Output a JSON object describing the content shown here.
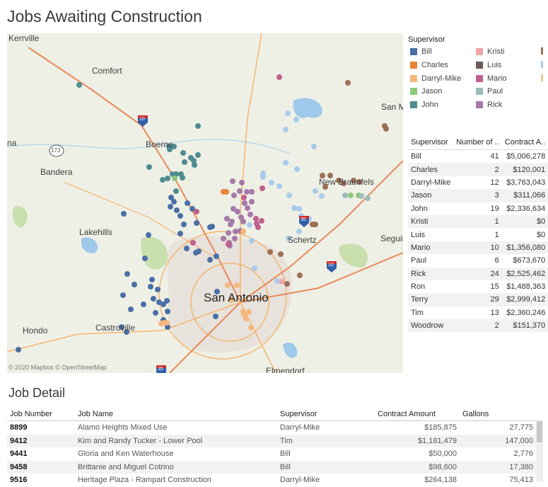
{
  "title": "Jobs Awaiting Construction",
  "map": {
    "attribution": "© 2020 Mapbox  © OpenStreetMap",
    "places": {
      "kerrville": "Kerrville",
      "comfort": "Comfort",
      "boerne": "Boerne",
      "bandera": "Bandera",
      "lakehills": "Lakehills",
      "castroville": "Castroville",
      "hondo": "Hondo",
      "san_antonio": "San Antonio",
      "schertz": "Schertz",
      "new_braunfels": "New Braunfels",
      "seguin": "Seguin",
      "san_marcos": "San Ma",
      "elmendorf": "Elmendorf",
      "helotes": "na"
    },
    "shields": {
      "i10_north": "10",
      "i35_ne": "35",
      "i10_east": "10",
      "i35_south": "35",
      "hwy_173": "173"
    },
    "colors": {
      "water": "#9fc9ea",
      "park": "#c9dfae",
      "urban": "#e7e2dc",
      "road": "#f4b56f",
      "highway": "#e7895a"
    }
  },
  "legend": {
    "title": "Supervisor",
    "items": [
      {
        "name": "Bill",
        "color": "#4a6fa5"
      },
      {
        "name": "Charles",
        "color": "#e8843a"
      },
      {
        "name": "Darryl-Mike",
        "color": "#f5b77b"
      },
      {
        "name": "Jason",
        "color": "#8dc97b"
      },
      {
        "name": "John",
        "color": "#4f8c8f"
      },
      {
        "name": "Kristi",
        "color": "#f0a3a7"
      },
      {
        "name": "Luis",
        "color": "#6a5a52"
      },
      {
        "name": "Mario",
        "color": "#c0608e"
      },
      {
        "name": "Paul",
        "color": "#9bbcbb"
      },
      {
        "name": "Rick",
        "color": "#a57aa8"
      }
    ],
    "overflow_colors": [
      "#9c6f55",
      "#a9cbea",
      "#f2c88f"
    ]
  },
  "summary": {
    "headers": [
      "Supervisor",
      "Number of ..",
      "Contract A.."
    ],
    "rows": [
      [
        "Bill",
        "41",
        "$5,006,278"
      ],
      [
        "Charles",
        "2",
        "$120,001"
      ],
      [
        "Darryl-Mike",
        "12",
        "$3,763,043"
      ],
      [
        "Jason",
        "3",
        "$311,066"
      ],
      [
        "John",
        "19",
        "$2,336,634"
      ],
      [
        "Kristi",
        "1",
        "$0"
      ],
      [
        "Luis",
        "1",
        "$0"
      ],
      [
        "Mario",
        "10",
        "$1,356,080"
      ],
      [
        "Paul",
        "6",
        "$673,670"
      ],
      [
        "Rick",
        "24",
        "$2,525,462"
      ],
      [
        "Ron",
        "15",
        "$1,488,363"
      ],
      [
        "Terry",
        "29",
        "$2,999,412"
      ],
      [
        "Tim",
        "13",
        "$2,360,246"
      ],
      [
        "Woodrow",
        "2",
        "$151,370"
      ]
    ]
  },
  "job_detail": {
    "title": "Job Detail",
    "headers": [
      "Job Number",
      "Job Name",
      "Supervisor",
      "Contract Amount",
      "Gallons"
    ],
    "rows": [
      [
        "8899",
        "Alamo Heights Mixed Use",
        "Darryl-Mike",
        "$185,875",
        "27,775"
      ],
      [
        "9412",
        "Kim and Randy Tucker - Lower Pool",
        "Tim",
        "$1,181,479",
        "147,000"
      ],
      [
        "9441",
        "Gloria and Ken Waterhouse",
        "Bill",
        "$50,000",
        "2,776"
      ],
      [
        "9458",
        "Brittanie and Miguel Cotrino",
        "Bill",
        "$98,600",
        "17,380"
      ],
      [
        "9516",
        "Heritage Plaza - Rampart Construction",
        "Darryl-Mike",
        "$264,138",
        "75,413"
      ]
    ]
  }
}
